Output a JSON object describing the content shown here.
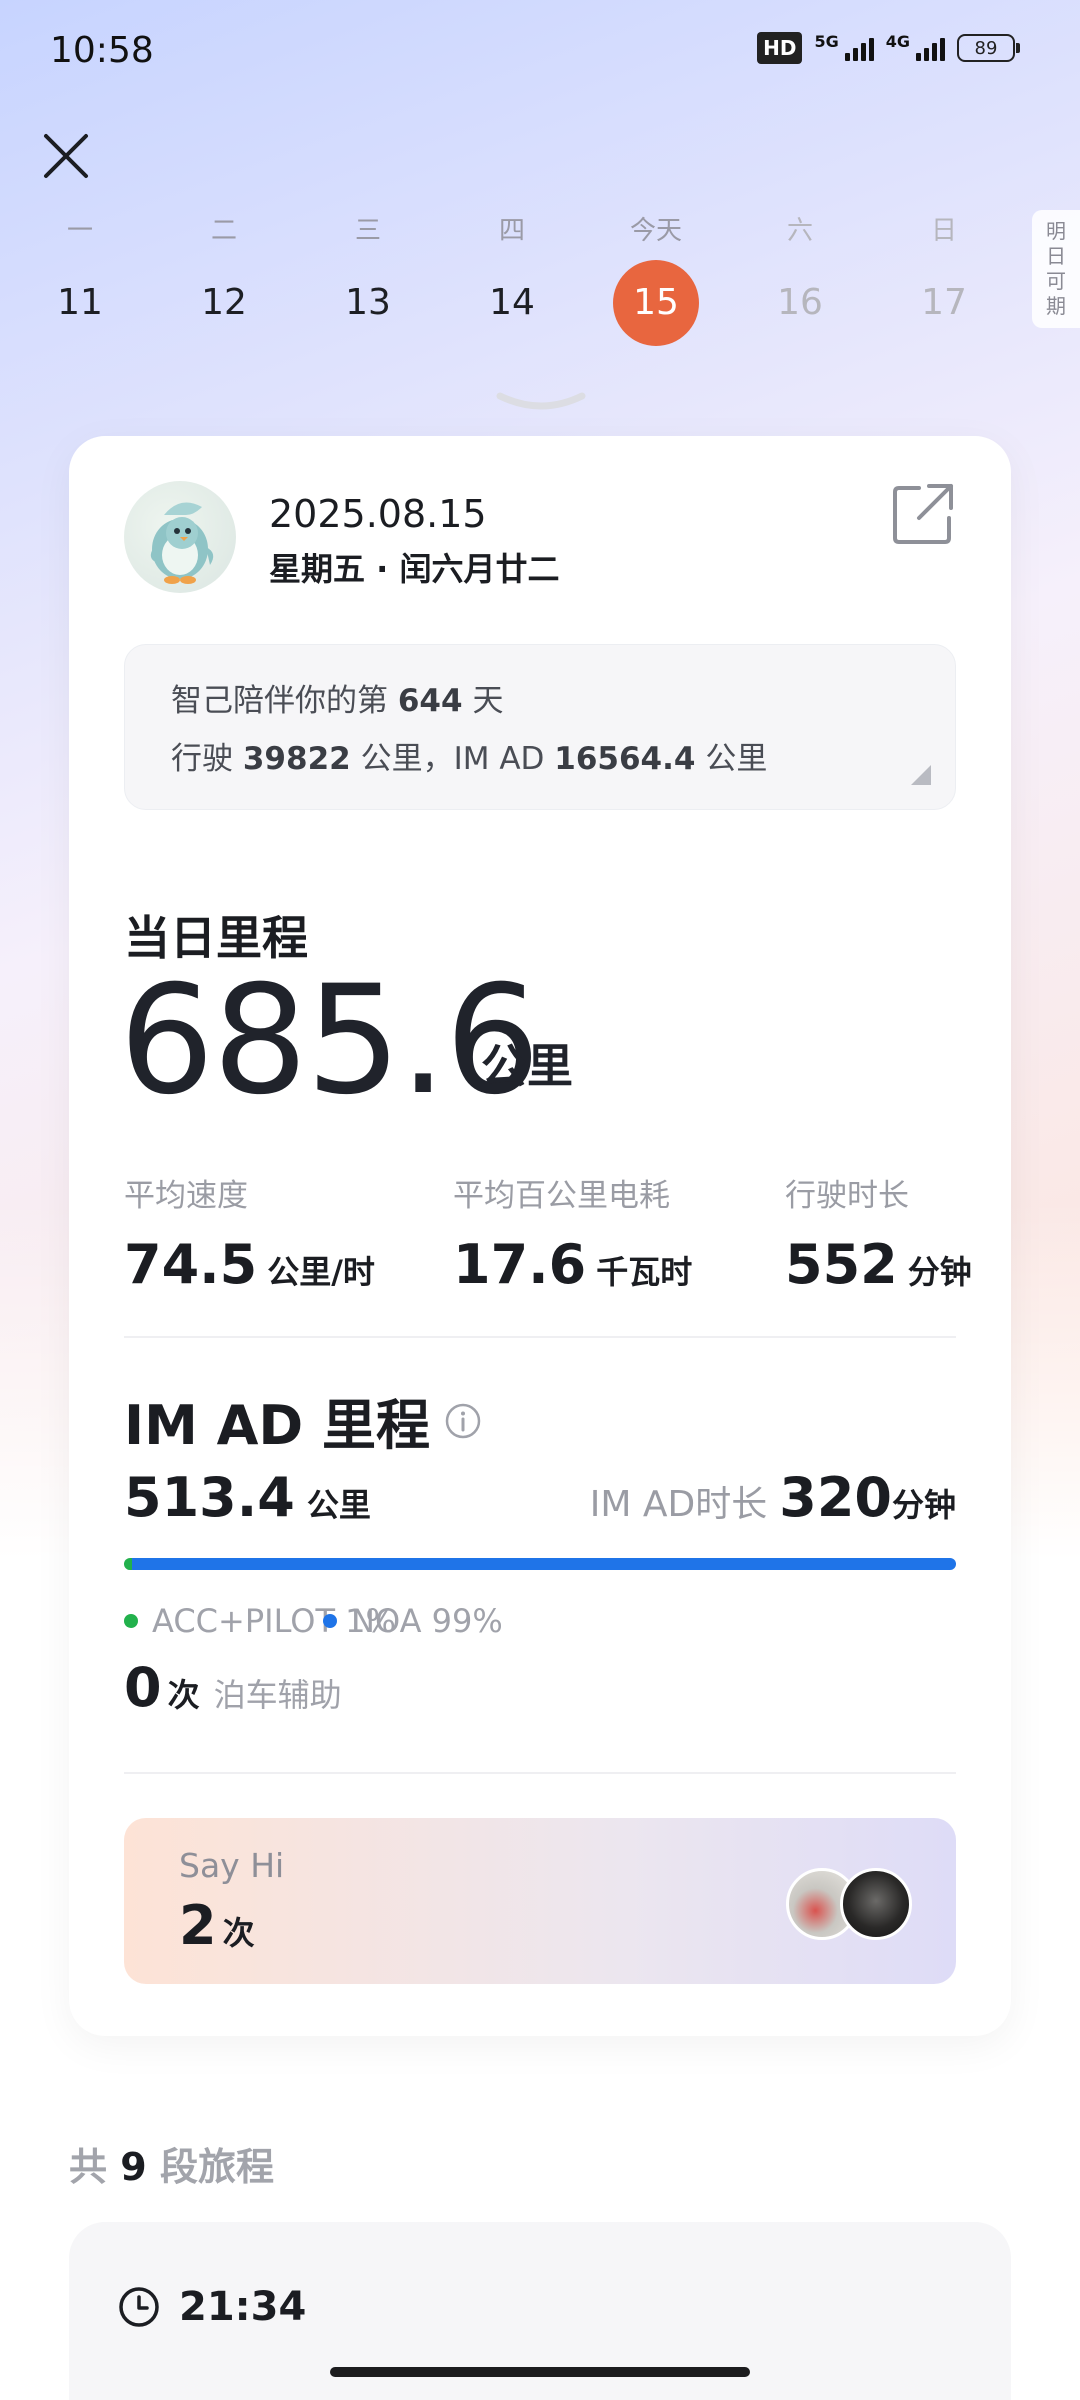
{
  "status_bar": {
    "time": "10:58",
    "hd_label": "HD",
    "network_1": "5G",
    "network_2": "4G",
    "battery": "89"
  },
  "week": {
    "days": [
      {
        "label": "一",
        "num": "11",
        "state": "past"
      },
      {
        "label": "二",
        "num": "12",
        "state": "past"
      },
      {
        "label": "三",
        "num": "13",
        "state": "past"
      },
      {
        "label": "四",
        "num": "14",
        "state": "past"
      },
      {
        "label": "今天",
        "num": "15",
        "state": "today"
      },
      {
        "label": "六",
        "num": "16",
        "state": "future"
      },
      {
        "label": "日",
        "num": "17",
        "state": "future"
      }
    ],
    "tomorrow_tab": [
      "明",
      "日",
      "可",
      "期"
    ],
    "today_color": "#e8663f"
  },
  "card": {
    "date": "2025.08.15",
    "date_sub": "星期五 · 闰六月廿二",
    "companion": {
      "prefix": "智己陪伴你的第",
      "days": "644",
      "suffix": "天"
    },
    "distance_line": {
      "prefix": "行驶",
      "total_km": "39822",
      "mid": "公里，IM AD",
      "imad_km": "16564.4",
      "suffix": "公里"
    },
    "daily": {
      "title": "当日里程",
      "value": "685.6",
      "unit": "公里"
    },
    "stats": [
      {
        "label": "平均速度",
        "value": "74.5",
        "unit": "公里/时"
      },
      {
        "label": "平均百公里电耗",
        "value": "17.6",
        "unit": "千瓦时"
      },
      {
        "label": "行驶时长",
        "value": "552",
        "unit": "分钟"
      }
    ],
    "imad": {
      "title": "IM AD 里程",
      "km": "513.4",
      "km_unit": "公里",
      "duration_label": "IM AD时长",
      "duration": "320",
      "duration_unit": "分钟",
      "acc_percent": 1,
      "noa_percent": 99,
      "acc_label": "ACC+PILOT 1%",
      "noa_label": "NOA 99%",
      "acc_color": "#22b14c",
      "noa_color": "#1f74e8"
    },
    "parking": {
      "count": "0",
      "unit": "次",
      "label": "泊车辅助"
    },
    "sayhi": {
      "title": "Say Hi",
      "count": "2",
      "unit": "次"
    }
  },
  "trips": {
    "prefix": "共",
    "count": "9",
    "suffix": "段旅程",
    "first_time": "21:34"
  }
}
